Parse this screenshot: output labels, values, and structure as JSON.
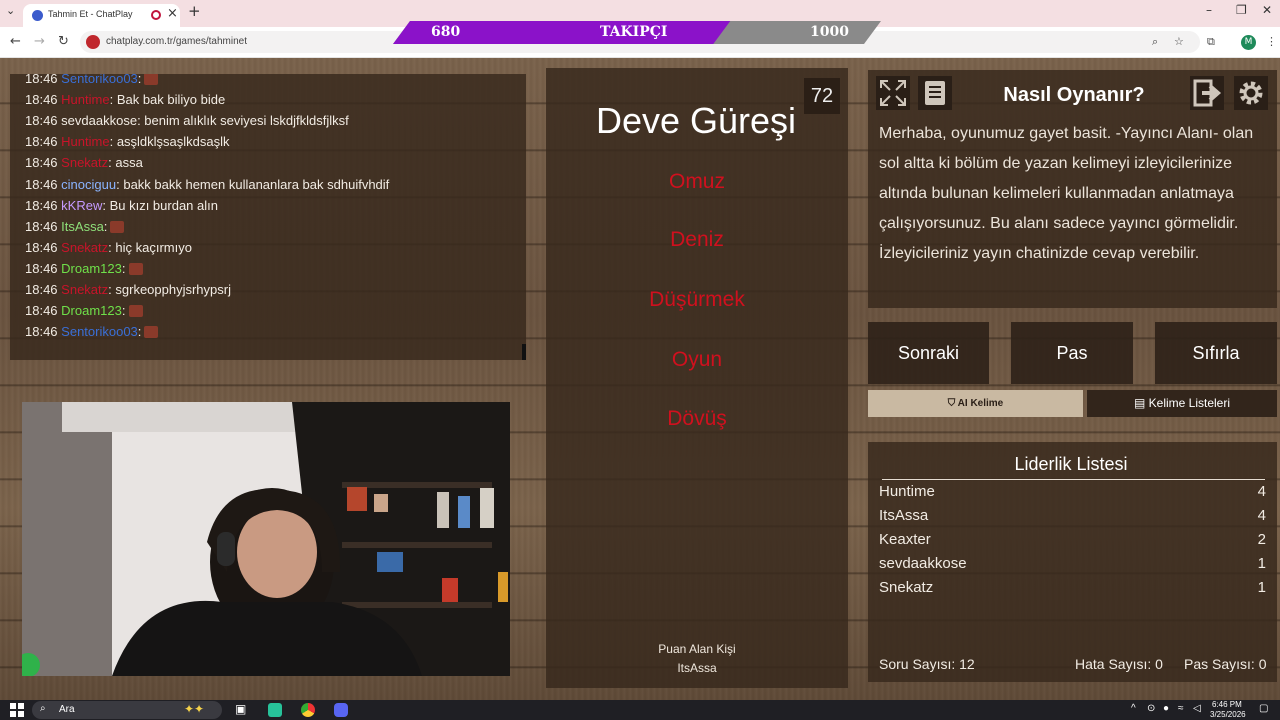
{
  "browser": {
    "tab_title": "Tahmin Et - ChatPlay",
    "url": "chatplay.com.tr/games/tahminet",
    "profile_initial": "M"
  },
  "followers": {
    "current": "680",
    "label": "TAKIPÇI",
    "goal": "1000",
    "progress": 0.68,
    "fill_color": "#8b12c9",
    "rest_color": "#8a8a8a"
  },
  "chat": {
    "messages": [
      {
        "time": "18:46",
        "user": "Sentorikoo03",
        "user_color": "#3a6fd6",
        "text": ":",
        "emote": true
      },
      {
        "time": "18:46",
        "user": "Huntime",
        "user_color": "#c8142a",
        "text": ": Bak bak biliyo bide",
        "emote": false
      },
      {
        "time": "18:46",
        "user": "sevdaakkose",
        "user_color": "#f2ece4",
        "text": ": benim alıklık seviyesi lskdjfkldsfjlksf",
        "emote": false
      },
      {
        "time": "18:46",
        "user": "Huntime",
        "user_color": "#c8142a",
        "text": ": asşldklşsaşlkdsaşlk",
        "emote": false
      },
      {
        "time": "18:46",
        "user": "Snekatz",
        "user_color": "#c8142a",
        "text": ": assa",
        "emote": false
      },
      {
        "time": "18:46",
        "user": "cinociguu",
        "user_color": "#8ab4ff",
        "text": ": bakk bakk hemen kullananlara bak sdhuifvhdif",
        "emote": false
      },
      {
        "time": "18:46",
        "user": "kKRew",
        "user_color": "#c59aff",
        "text": ": Bu kızı burdan alın",
        "emote": false
      },
      {
        "time": "18:46",
        "user": "ItsAssa",
        "user_color": "#8fe07a",
        "text": ":",
        "emote": true
      },
      {
        "time": "18:46",
        "user": "Snekatz",
        "user_color": "#c8142a",
        "text": ": hiç kaçırmıyo",
        "emote": false
      },
      {
        "time": "18:46",
        "user": "Droam123",
        "user_color": "#6fe04a",
        "text": ":",
        "emote": true
      },
      {
        "time": "18:46",
        "user": "Snekatz",
        "user_color": "#c8142a",
        "text": ": sgrkeopphyjsrhypsrj",
        "emote": false
      },
      {
        "time": "18:46",
        "user": "Droam123",
        "user_color": "#6fe04a",
        "text": ":",
        "emote": true
      },
      {
        "time": "18:46",
        "user": "Sentorikoo03",
        "user_color": "#3a6fd6",
        "text": ":",
        "emote": true
      }
    ]
  },
  "game": {
    "word": "Deve Güreşi",
    "timer": "72",
    "forbidden_words": [
      "Omuz",
      "Deniz",
      "Düşürmek",
      "Oyun",
      "Dövüş"
    ],
    "scorer_label": "Puan Alan Kişi",
    "scorer_name": "ItsAssa"
  },
  "howto": {
    "title": "Nasıl Oynanır?",
    "text": "Merhaba, oyunumuz gayet basit. -Yayıncı Alanı- olan sol altta ki bölüm de yazan kelimeyi izleyicilerinize altında bulunan kelimeleri kullanmadan anlatmaya çalışıyorsunuz. Bu alanı sadece yayıncı görmelidir. İzleyicileriniz yayın chatinizde cevap verebilir."
  },
  "actions": {
    "next": "Sonraki",
    "pass": "Pas",
    "reset": "Sıfırla",
    "ai_word": "AI Kelime",
    "word_lists": "Kelime Listeleri"
  },
  "leaderboard": {
    "title": "Liderlik Listesi",
    "rows": [
      {
        "name": "Huntime",
        "score": "4"
      },
      {
        "name": "ItsAssa",
        "score": "4"
      },
      {
        "name": "Keaxter",
        "score": "2"
      },
      {
        "name": "sevdaakkose",
        "score": "1"
      },
      {
        "name": "Snekatz",
        "score": "1"
      }
    ]
  },
  "stats": {
    "questions": "Soru Sayısı: 12",
    "errors": "Hata Sayısı: 0",
    "passes": "Pas Sayısı: 0"
  },
  "taskbar": {
    "search_placeholder": "Ara",
    "time": "6:46 PM",
    "date": "3/25/2026"
  }
}
